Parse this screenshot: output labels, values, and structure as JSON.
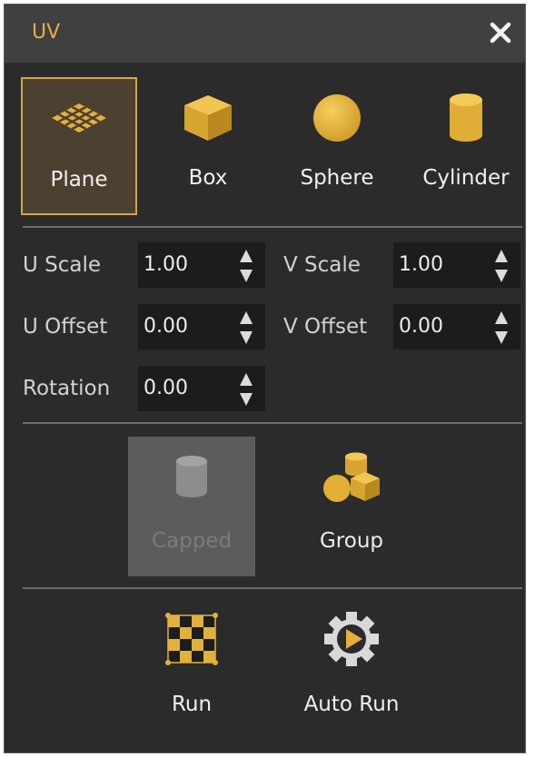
{
  "window": {
    "title": "UV",
    "close_icon": "close-icon"
  },
  "colors": {
    "accent": "#e2b13c",
    "panel_bg": "#2b2b2b",
    "titlebar_bg": "#404040",
    "field_bg": "#1c1c1c",
    "selected_border": "#d6a935"
  },
  "projection": {
    "selected": "Plane",
    "items": [
      {
        "label": "Plane",
        "icon": "plane-grid-icon"
      },
      {
        "label": "Box",
        "icon": "box-cube-icon"
      },
      {
        "label": "Sphere",
        "icon": "sphere-icon"
      },
      {
        "label": "Cylinder",
        "icon": "cylinder-icon"
      }
    ]
  },
  "params": {
    "u_scale": {
      "label": "U Scale",
      "value": "1.00"
    },
    "v_scale": {
      "label": "V Scale",
      "value": "1.00"
    },
    "u_offset": {
      "label": "U Offset",
      "value": "0.00"
    },
    "v_offset": {
      "label": "V Offset",
      "value": "0.00"
    },
    "rotation": {
      "label": "Rotation",
      "value": "0.00"
    }
  },
  "options": {
    "capped": {
      "label": "Capped",
      "icon": "cylinder-icon",
      "enabled": false
    },
    "group": {
      "label": "Group",
      "icon": "group-shapes-icon",
      "enabled": true
    }
  },
  "actions": {
    "run": {
      "label": "Run",
      "icon": "checker-grid-icon"
    },
    "auto_run": {
      "label": "Auto Run",
      "icon": "gear-play-icon"
    }
  }
}
